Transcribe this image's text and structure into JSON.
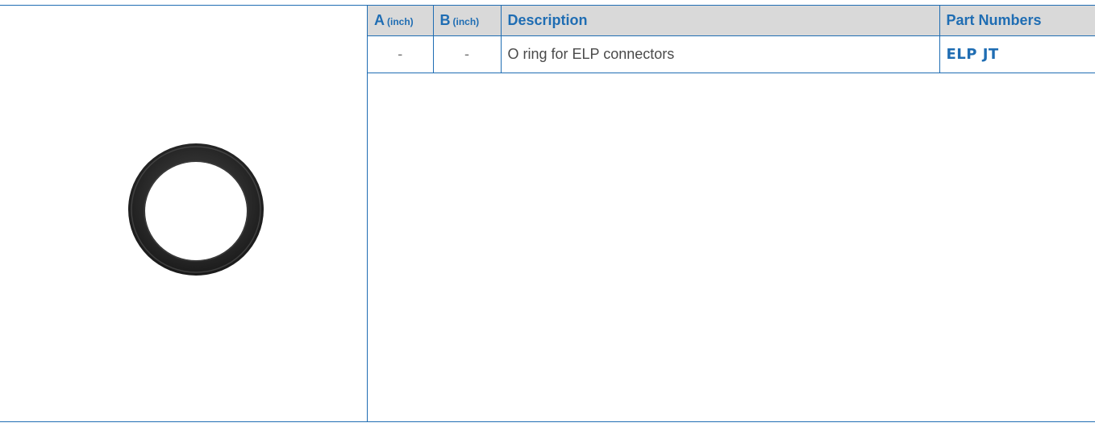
{
  "table": {
    "headers": [
      {
        "label": "A",
        "unit": "(inch)"
      },
      {
        "label": "B",
        "unit": "(inch)"
      },
      {
        "label": "Description",
        "unit": ""
      },
      {
        "label": "Part Numbers",
        "unit": ""
      }
    ],
    "rows": [
      {
        "a": "-",
        "b": "-",
        "description": "O ring for ELP connectors",
        "part_number": "ELP JT"
      }
    ]
  },
  "product_image": {
    "icon": "o-ring-image",
    "color": "#2b2b2b"
  },
  "colors": {
    "accent": "#1f6db3",
    "header_bg": "#d9d9d9",
    "body_text": "#4a4a4a"
  }
}
